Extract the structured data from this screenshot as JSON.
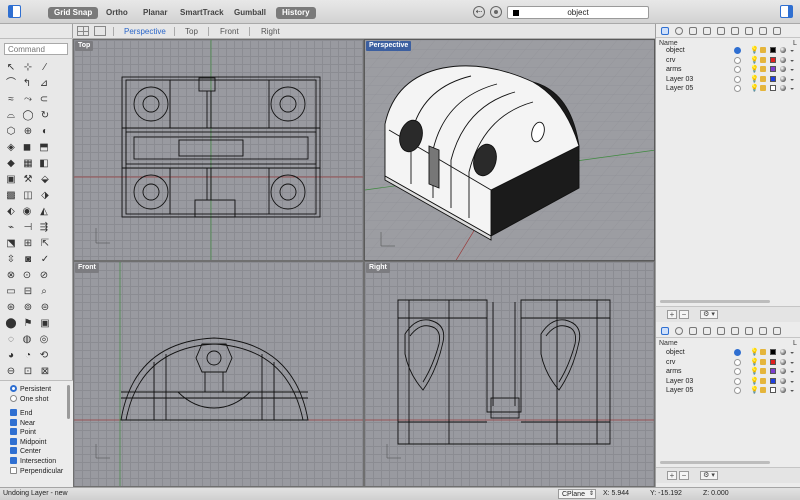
{
  "toolbar": {
    "modes": [
      {
        "label": "Grid Snap",
        "active": true
      },
      {
        "label": "Ortho",
        "active": false
      },
      {
        "label": "Planar",
        "active": false
      },
      {
        "label": "SmartTrack",
        "active": false
      },
      {
        "label": "Gumball",
        "active": false
      },
      {
        "label": "History",
        "active": true
      }
    ],
    "current_layer": "object",
    "current_layer_color": "#000000"
  },
  "command": {
    "placeholder": "Command"
  },
  "tools": [
    "↖",
    "⊹",
    "∕",
    "⌒",
    "↰",
    "⊿",
    "≈",
    "⤳",
    "⊂",
    "⌓",
    "◯",
    "↻",
    "⬡",
    "⊕",
    "◐",
    "◈",
    "◼",
    "⬒",
    "◆",
    "▦",
    "◧",
    "▣",
    "⚒",
    "⬙",
    "▩",
    "◫",
    "⬗",
    "⬖",
    "◉",
    "◭",
    "⌁",
    "⊣",
    "⇶",
    "⬔",
    "⊞",
    "⇱",
    "⇳",
    "◙",
    "✓",
    "⊗",
    "⊙",
    "⊘",
    "▭",
    "⊟",
    "⌕",
    "⊛",
    "⊚",
    "⊜",
    "⬤",
    "⚑",
    "▣",
    "◌",
    "◍",
    "◎",
    "◕",
    "◔",
    "⟲",
    "⊖",
    "⊡",
    "⊠"
  ],
  "osnap": {
    "persistent": "Persistent",
    "one_shot": "One shot",
    "mode": "Persistent",
    "items": [
      {
        "label": "End",
        "checked": true
      },
      {
        "label": "Near",
        "checked": true
      },
      {
        "label": "Point",
        "checked": true
      },
      {
        "label": "Midpoint",
        "checked": true
      },
      {
        "label": "Center",
        "checked": true
      },
      {
        "label": "Intersection",
        "checked": true
      },
      {
        "label": "Perpendicular",
        "checked": false
      }
    ]
  },
  "viewport_tabs": [
    "Perspective",
    "Top",
    "Front",
    "Right"
  ],
  "active_tab": "Perspective",
  "viewports": {
    "top": "Top",
    "perspective": "Perspective",
    "front": "Front",
    "right": "Right"
  },
  "layers_panel": {
    "header_name": "Name",
    "header_l": "L",
    "layers": [
      {
        "name": "object",
        "current": true,
        "color": "#000000"
      },
      {
        "name": "crv",
        "current": false,
        "color": "#e02020"
      },
      {
        "name": "arms",
        "current": false,
        "color": "#7c3fd0"
      },
      {
        "name": "Layer 03",
        "current": false,
        "color": "#2040e0"
      },
      {
        "name": "Layer 05",
        "current": false,
        "color": "#ffffff"
      }
    ]
  },
  "footer_buttons": {
    "add": "+",
    "remove": "−",
    "gear": "⚙ ▾"
  },
  "status": {
    "message": "Undoing Layer - new",
    "cplane": "CPlane",
    "x": "X: 5.944",
    "y": "Y: -15.192",
    "z": "Z: 0.000"
  }
}
